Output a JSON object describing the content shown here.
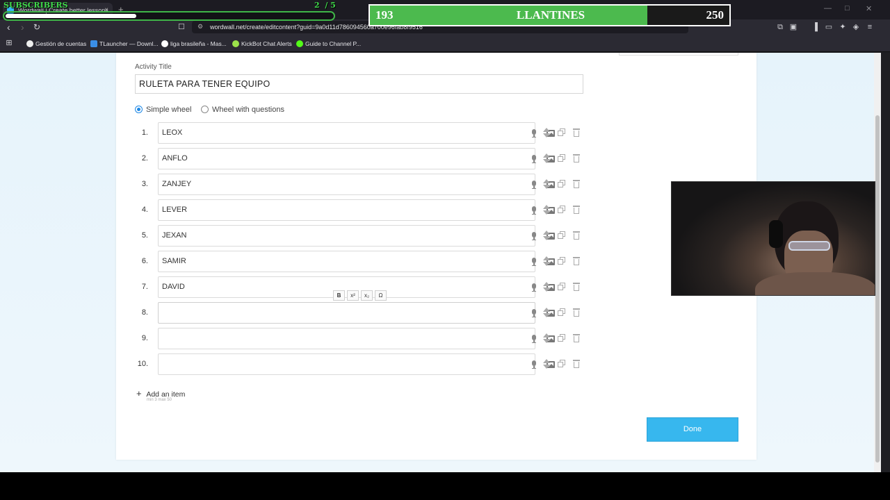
{
  "browser": {
    "tab_title": "Wordwall | Create better lessons",
    "tab_close": "×",
    "new_tab": "+",
    "url": "wordwall.net/create/editcontent?guid=9a0d11d786094560a700e96fab8f9516",
    "window_controls": [
      "—",
      "□",
      "✕"
    ]
  },
  "bookmarks": [
    {
      "label": "Gestión de cuentas",
      "icon": "ea-icon",
      "color": "#eeeeee"
    },
    {
      "label": "TLauncher — Downl...",
      "icon": "tlauncher-icon",
      "color": "#3a8ee6"
    },
    {
      "label": "liga brasileña - Mas...",
      "icon": "google-icon",
      "color": "#ffffff"
    },
    {
      "label": "KickBot Chat Alerts",
      "icon": "kickbot-icon",
      "color": "#9be24a"
    },
    {
      "label": "Guide to Channel P...",
      "icon": "kick-icon",
      "color": "#53fc18"
    }
  ],
  "overlay": {
    "label": "SUBSCRIBERS",
    "count": "2",
    "total": "/ 5",
    "progress": 0.4,
    "goal_current": "193",
    "goal_name": "LLANTINES",
    "goal_target": "250",
    "goal_progress": 0.772,
    "colors": {
      "green": "#4cba4e",
      "label_green": "#3fd94a"
    }
  },
  "editor": {
    "activity_label": "Activity Title",
    "activity_title": "RULETA PARA TENER EQUIPO",
    "options": [
      {
        "label": "Simple wheel",
        "checked": true
      },
      {
        "label": "Wheel with questions",
        "checked": false
      }
    ],
    "items": [
      {
        "num": "1.",
        "value": "LEOX"
      },
      {
        "num": "2.",
        "value": "ANFLO"
      },
      {
        "num": "3.",
        "value": "ZANJEY"
      },
      {
        "num": "4.",
        "value": "LEVER"
      },
      {
        "num": "5.",
        "value": "JEXAN"
      },
      {
        "num": "6.",
        "value": "SAMIR"
      },
      {
        "num": "7.",
        "value": "DAVID"
      },
      {
        "num": "8.",
        "value": ""
      },
      {
        "num": "9.",
        "value": ""
      },
      {
        "num": "10.",
        "value": ""
      }
    ],
    "format_buttons": [
      "B",
      "x²",
      "x₂",
      "Ω"
    ],
    "add_item": "Add an item",
    "add_hint": "min 3   max 50",
    "done": "Done",
    "accent": "#37b7ee"
  }
}
